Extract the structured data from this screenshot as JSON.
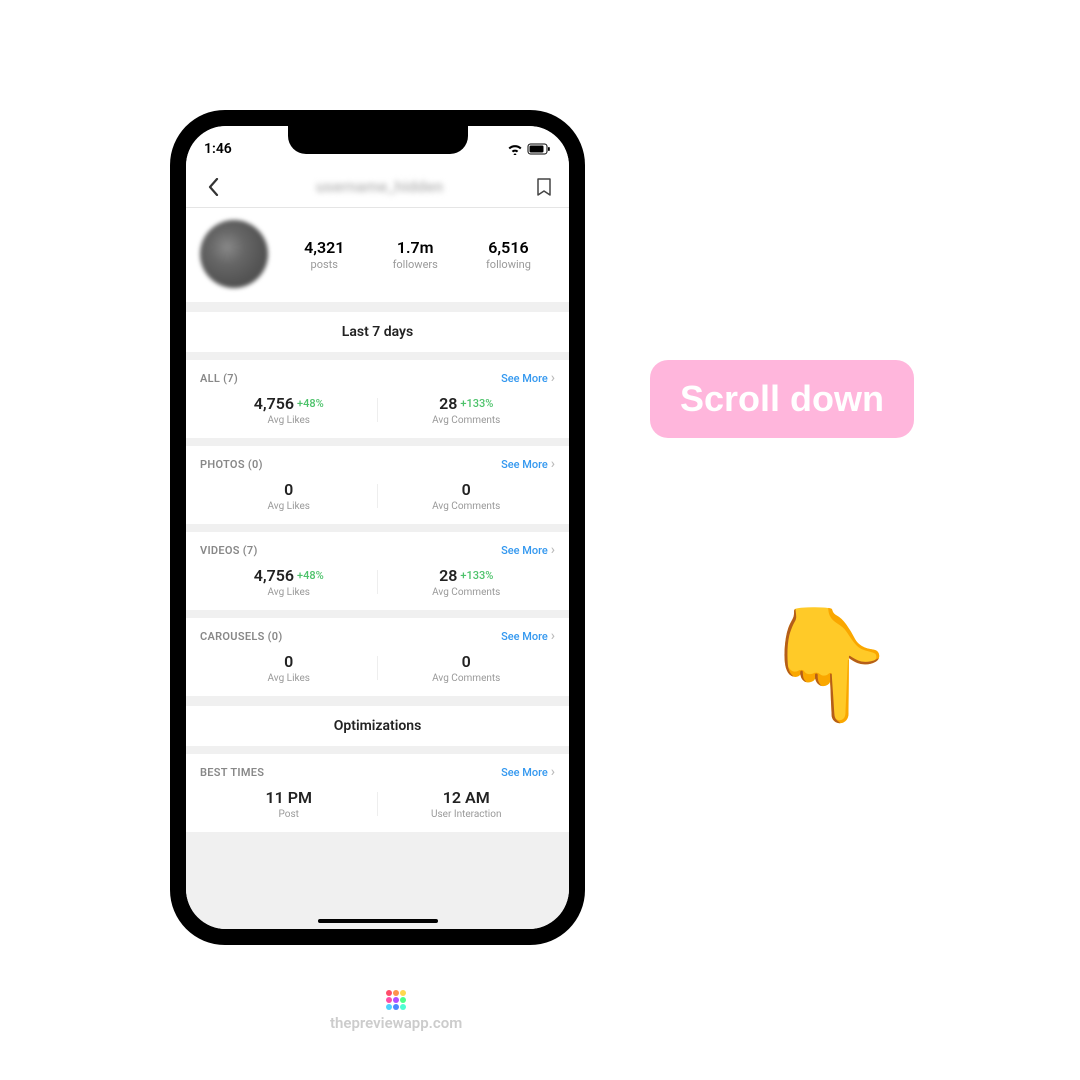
{
  "status": {
    "time": "1:46"
  },
  "header": {
    "title": "username_hidden"
  },
  "profile": {
    "posts": {
      "value": "4,321",
      "label": "posts"
    },
    "followers": {
      "value": "1.7m",
      "label": "followers"
    },
    "following": {
      "value": "6,516",
      "label": "following"
    }
  },
  "period_title": "Last 7 days",
  "see_more_label": "See More",
  "sections": {
    "all": {
      "label": "ALL (7)",
      "likes": "4,756",
      "likes_change": "+48%",
      "comments": "28",
      "comments_change": "+133%"
    },
    "photos": {
      "label": "PHOTOS (0)",
      "likes": "0",
      "likes_change": "",
      "comments": "0",
      "comments_change": ""
    },
    "videos": {
      "label": "VIDEOS (7)",
      "likes": "4,756",
      "likes_change": "+48%",
      "comments": "28",
      "comments_change": "+133%"
    },
    "carousels": {
      "label": "CAROUSELS (0)",
      "likes": "0",
      "likes_change": "",
      "comments": "0",
      "comments_change": ""
    }
  },
  "metric_labels": {
    "likes": "Avg Likes",
    "comments": "Avg Comments"
  },
  "optimizations_title": "Optimizations",
  "best_times": {
    "label": "BEST TIMES",
    "post_time": "11 PM",
    "post_label": "Post",
    "interaction_time": "12 AM",
    "interaction_label": "User Interaction"
  },
  "callout": "Scroll down",
  "watermark": "thepreviewapp.com"
}
